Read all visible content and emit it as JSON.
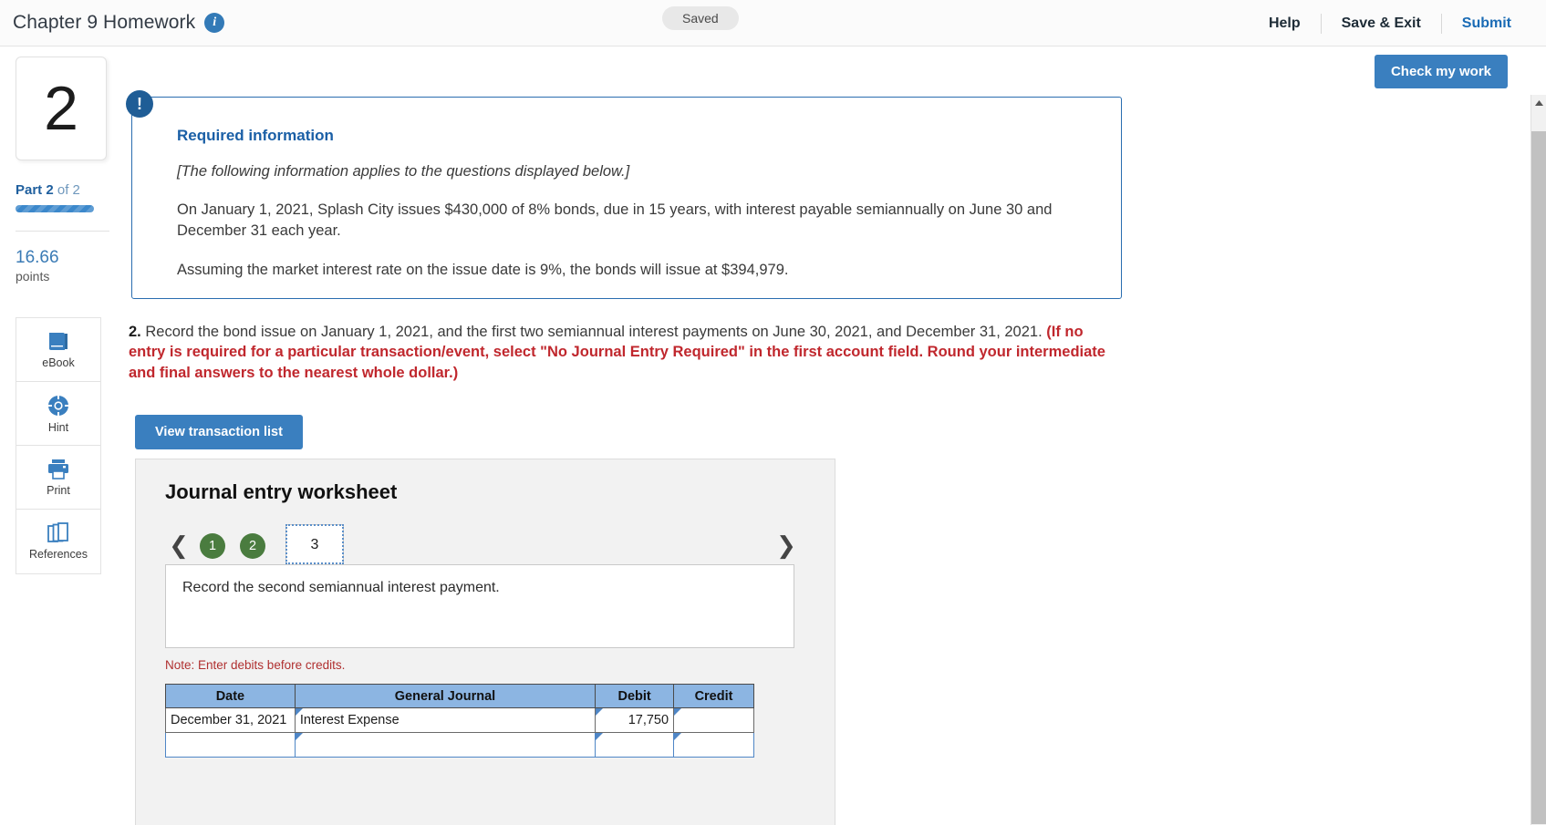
{
  "header": {
    "title": "Chapter 9 Homework",
    "info_icon": "info-icon",
    "saved_label": "Saved",
    "help_label": "Help",
    "save_exit_label": "Save & Exit",
    "submit_label": "Submit"
  },
  "rail": {
    "question_number": "2",
    "part_prefix": "Part",
    "part_current": "2",
    "part_of": "of 2",
    "points_value": "16.66",
    "points_label": "points",
    "tools": [
      {
        "label": "eBook",
        "icon": "book-icon"
      },
      {
        "label": "Hint",
        "icon": "life-preserver-icon"
      },
      {
        "label": "Print",
        "icon": "printer-icon"
      },
      {
        "label": "References",
        "icon": "copy-pages-icon"
      }
    ]
  },
  "actions": {
    "check_my_work": "Check my work",
    "view_transaction_list": "View transaction list"
  },
  "required_information": {
    "heading": "Required information",
    "bracket_note": "[The following information applies to the questions displayed below.]",
    "paragraph_1": "On January 1, 2021, Splash City issues $430,000 of 8% bonds, due in 15 years, with interest payable semiannually on June 30 and December 31 each year.",
    "paragraph_2": "Assuming the market interest rate on the issue date is 9%, the bonds will issue at $394,979."
  },
  "question": {
    "number": "2.",
    "body": "Record the bond issue on January 1, 2021, and the first two semiannual interest payments on June 30, 2021, and December 31, 2021.",
    "red_instruction": "(If no entry is required for a particular transaction/event, select \"No Journal Entry Required\" in the first account field. Round your intermediate and final answers to the nearest whole dollar.)"
  },
  "worksheet": {
    "title": "Journal entry worksheet",
    "prev_icon": "chevron-left-icon",
    "next_icon": "chevron-right-icon",
    "tabs": [
      {
        "label": "1",
        "state": "completed"
      },
      {
        "label": "2",
        "state": "completed"
      },
      {
        "label": "3",
        "state": "active"
      }
    ],
    "prompt": "Record the second semiannual interest payment.",
    "note": "Note: Enter debits before credits.",
    "table": {
      "columns": [
        "Date",
        "General Journal",
        "Debit",
        "Credit"
      ],
      "rows": [
        {
          "date": "December 31, 2021",
          "account": "Interest Expense",
          "debit": "17,750",
          "credit": ""
        },
        {
          "date": "",
          "account": "",
          "debit": "",
          "credit": ""
        }
      ]
    }
  },
  "colors": {
    "accent_blue": "#3a7fbf",
    "panel_border_blue": "#2a6db0",
    "red_instruction": "#c0272d",
    "tab_green": "#4a7c3f",
    "table_header_blue": "#8cb5e2"
  }
}
